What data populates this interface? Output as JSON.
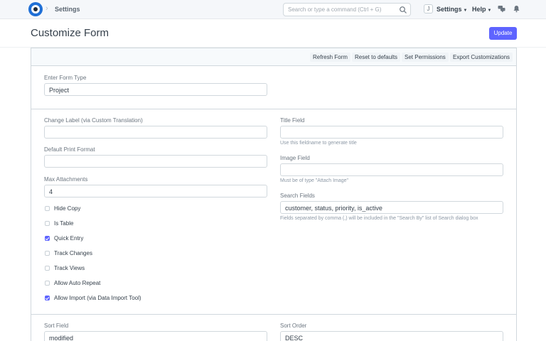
{
  "navbar": {
    "breadcrumb": "Settings",
    "search_placeholder": "Search or type a command (Ctrl + G)",
    "avatar_initial": "J",
    "settings_menu": "Settings",
    "help_menu": "Help"
  },
  "page": {
    "title": "Customize Form",
    "primary_action": "Update"
  },
  "toolbar": {
    "refresh": "Refresh Form",
    "reset": "Reset to defaults",
    "permissions": "Set Permissions",
    "export": "Export Customizations"
  },
  "form_type": {
    "label": "Enter Form Type",
    "value": "Project"
  },
  "left": {
    "change_label": {
      "label": "Change Label (via Custom Translation)",
      "value": ""
    },
    "print_format": {
      "label": "Default Print Format",
      "value": ""
    },
    "max_attachments": {
      "label": "Max Attachments",
      "value": "4"
    },
    "checkboxes": [
      {
        "label": "Hide Copy",
        "checked": false
      },
      {
        "label": "Is Table",
        "checked": false
      },
      {
        "label": "Quick Entry",
        "checked": true
      },
      {
        "label": "Track Changes",
        "checked": false
      },
      {
        "label": "Track Views",
        "checked": false
      },
      {
        "label": "Allow Auto Repeat",
        "checked": false
      },
      {
        "label": "Allow Import (via Data Import Tool)",
        "checked": true
      }
    ]
  },
  "right": {
    "title_field": {
      "label": "Title Field",
      "value": "",
      "help": "Use this fieldname to generate title"
    },
    "image_field": {
      "label": "Image Field",
      "value": "",
      "help": "Must be of type \"Attach Image\""
    },
    "search_fields": {
      "label": "Search Fields",
      "value": "customer, status, priority, is_active",
      "help": "Fields separated by comma (,) will be included in the \"Search By\" list of Search dialog box"
    }
  },
  "sort": {
    "field": {
      "label": "Sort Field",
      "value": "modified"
    },
    "order": {
      "label": "Sort Order",
      "value": "DESC"
    }
  },
  "colors": {
    "primary": "#5e64ff",
    "brand": "#1f6fd6"
  }
}
